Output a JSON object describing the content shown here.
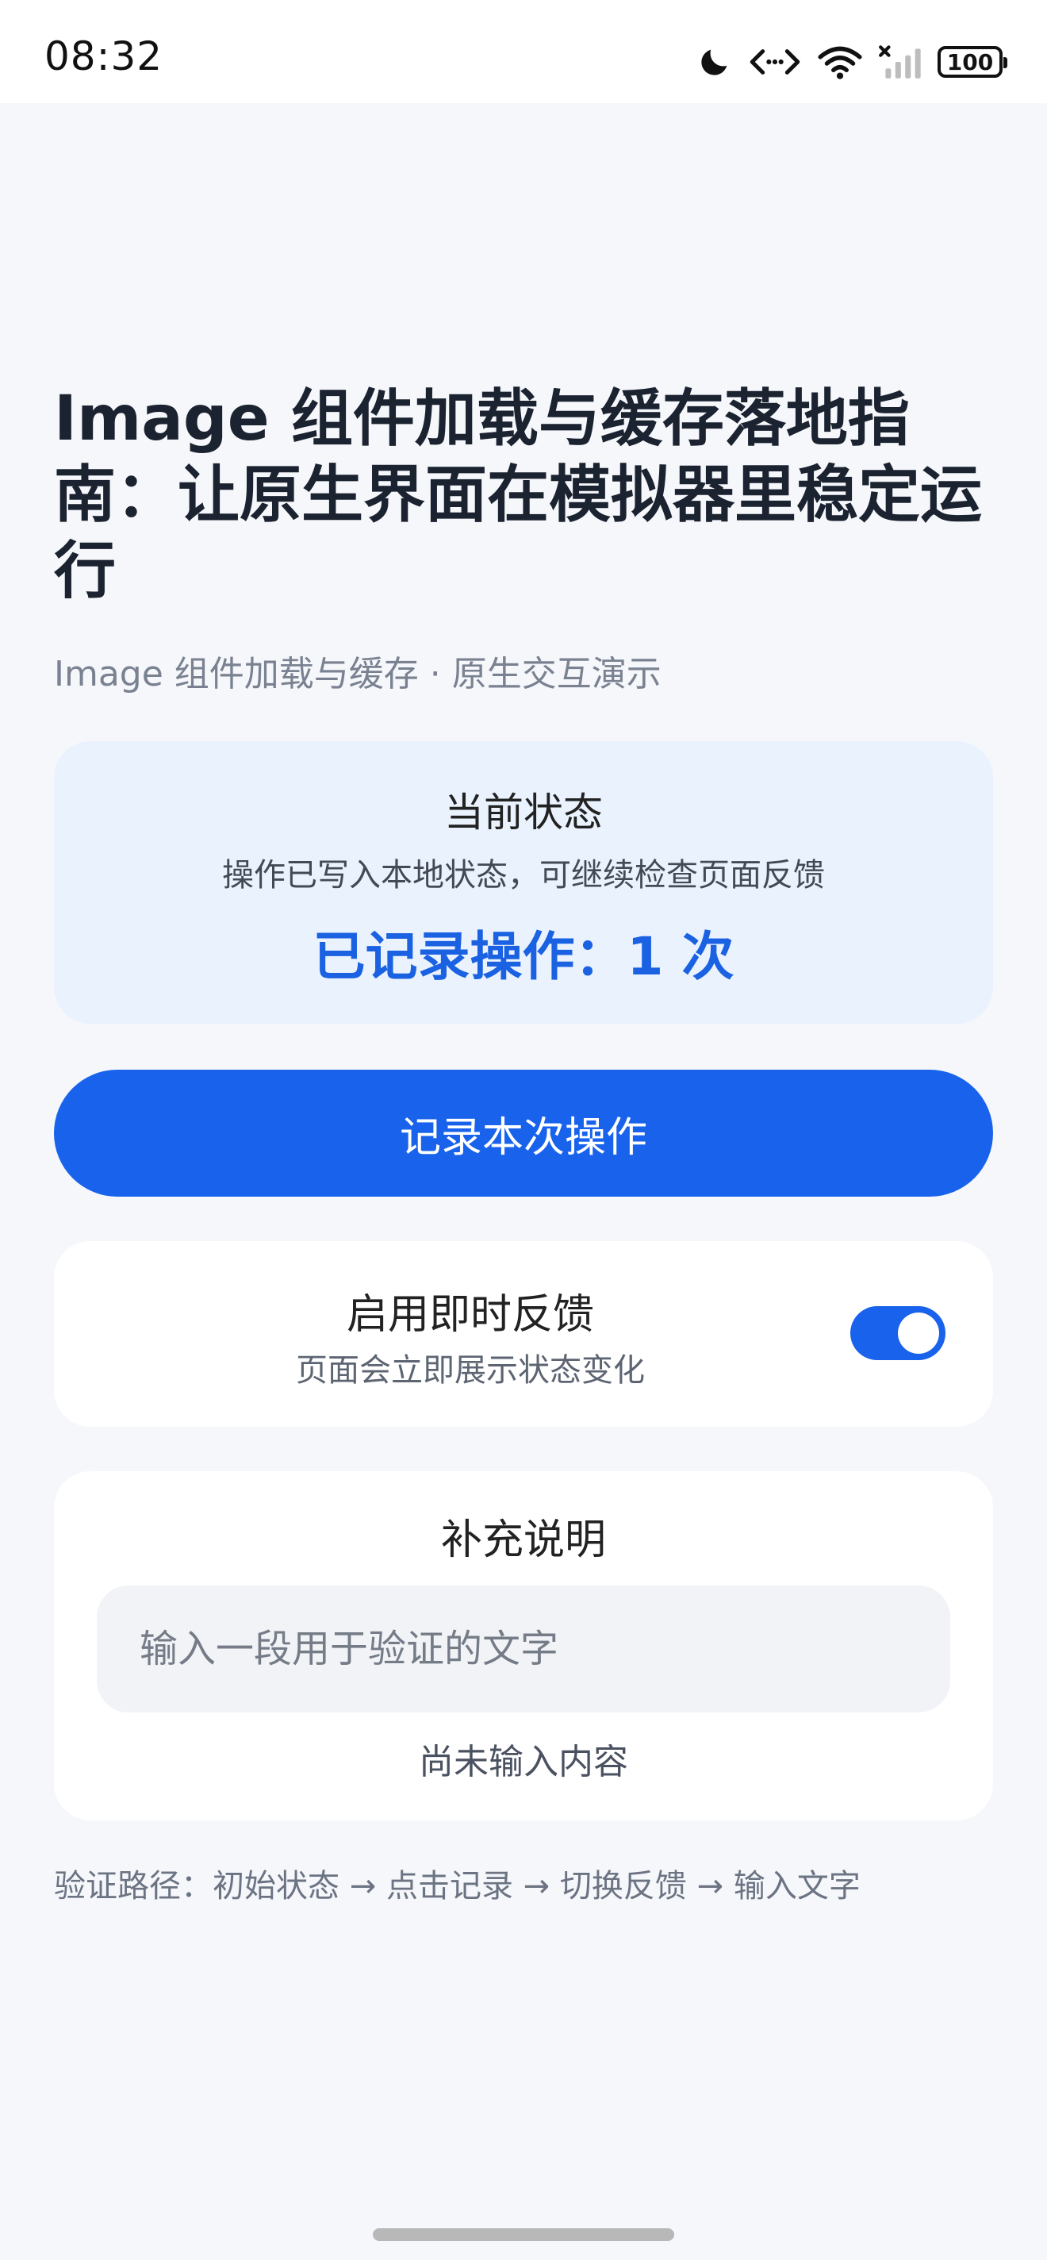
{
  "status_bar": {
    "time": "08:32",
    "battery": "100",
    "icons": [
      "moon-icon",
      "code-bracket-icon",
      "wifi-icon",
      "cellular-signal-icon",
      "battery-icon"
    ]
  },
  "page": {
    "title": "Image 组件加载与缓存落地指南：让原生界面在模拟器里稳定运行",
    "subtitle": "Image 组件加载与缓存 · 原生交互演示"
  },
  "status_card": {
    "title": "当前状态",
    "description": "操作已写入本地状态，可继续检查页面反馈",
    "count_text": "已记录操作：1 次"
  },
  "primary_button": {
    "label": "记录本次操作"
  },
  "toggle_card": {
    "title": "启用即时反馈",
    "description": "页面会立即展示状态变化",
    "enabled": true
  },
  "notes_card": {
    "title": "补充说明",
    "input_value": "",
    "input_placeholder": "输入一段用于验证的文字",
    "status": "尚未输入内容"
  },
  "footer": {
    "verify_path": "验证路径：初始状态 → 点击记录 → 切换反馈 → 输入文字"
  },
  "colors": {
    "accent": "#1862ec",
    "status_card_bg": "#eaf2fe",
    "page_bg": "#f5f7fb"
  }
}
